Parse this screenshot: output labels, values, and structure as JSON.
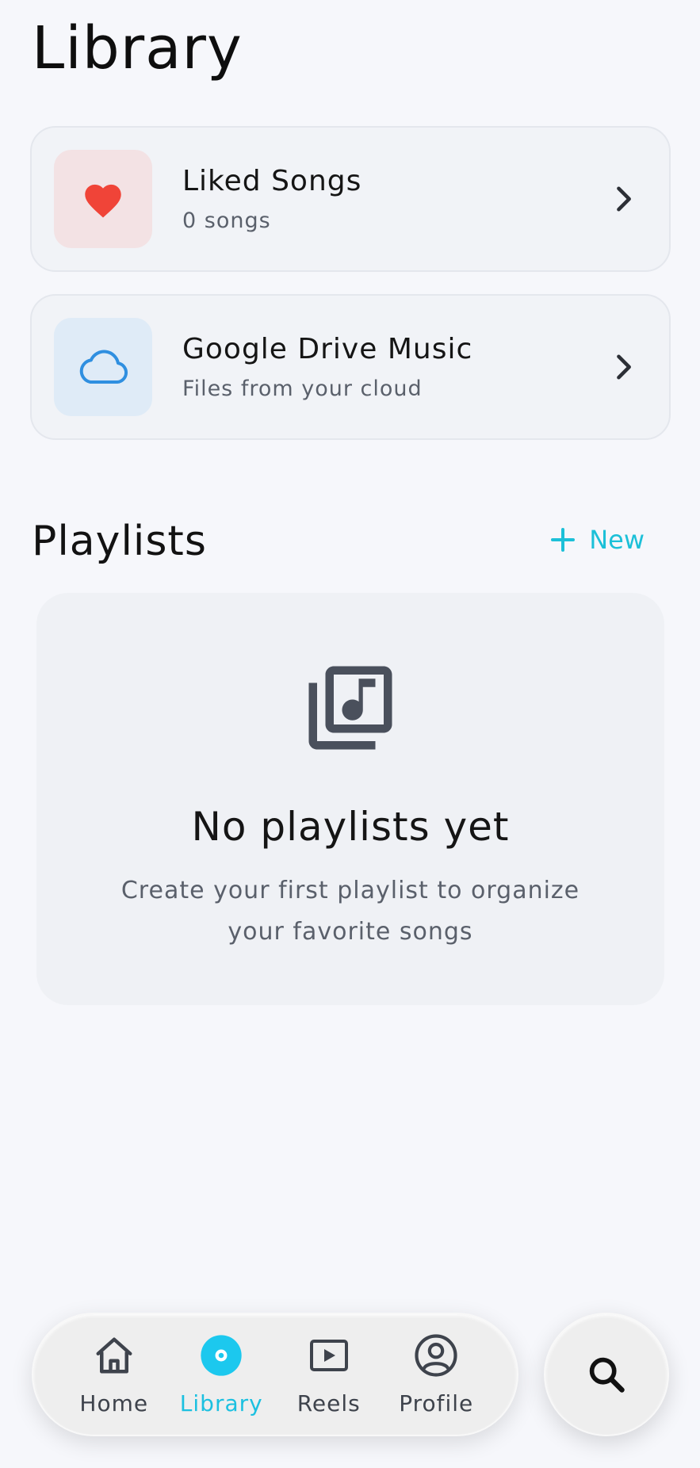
{
  "header": {
    "title": "Library"
  },
  "library_items": [
    {
      "title": "Liked Songs",
      "subtitle": "0 songs",
      "icon": "heart-icon",
      "icon_color": "#f04438"
    },
    {
      "title": "Google Drive Music",
      "subtitle": "Files from your cloud",
      "icon": "cloud-icon",
      "icon_color": "#2f8fe0"
    }
  ],
  "playlists": {
    "title": "Playlists",
    "new_label": "New",
    "empty_title": "No playlists yet",
    "empty_description": "Create your first playlist to organize your favorite songs"
  },
  "bottom_nav": {
    "items": [
      {
        "label": "Home",
        "icon": "home-icon",
        "active": false
      },
      {
        "label": "Library",
        "icon": "library-icon",
        "active": true
      },
      {
        "label": "Reels",
        "icon": "reels-icon",
        "active": false
      },
      {
        "label": "Profile",
        "icon": "profile-icon",
        "active": false
      }
    ],
    "search_icon": "search-icon"
  },
  "colors": {
    "accent": "#1cc0d8",
    "background": "#f6f7fb"
  }
}
